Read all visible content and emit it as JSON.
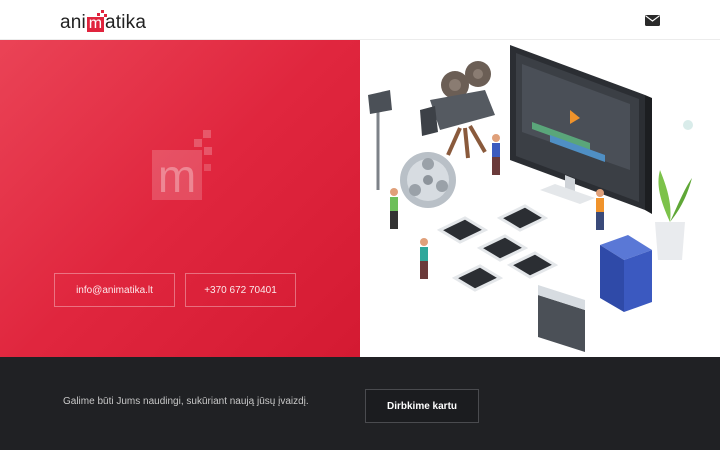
{
  "header": {
    "logo_prefix": "ani",
    "logo_m": "m",
    "logo_suffix": "atika",
    "mail_icon": "envelope-icon"
  },
  "hero": {
    "email": "info@animatika.lt",
    "phone": "+370 672 70401",
    "background_color": "#e0263e"
  },
  "footer": {
    "tagline": "Galime būti Jums naudingi, sukūriant naują jūsų įvaizdį.",
    "cta_label": "Dirbkime kartu"
  },
  "colors": {
    "brand_red": "#e0243d",
    "footer_dark": "#202124"
  }
}
